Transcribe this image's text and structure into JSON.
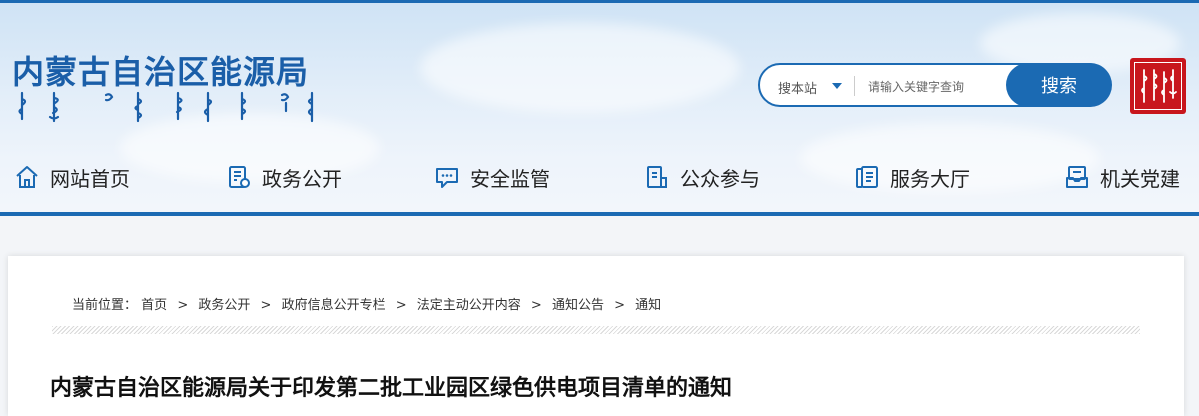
{
  "header": {
    "site_title": "内蒙古自治区能源局",
    "search": {
      "scope_label": "搜本站",
      "placeholder": "请输入关键字查询",
      "button_label": "搜索"
    }
  },
  "nav": {
    "items": [
      {
        "label": "网站首页",
        "icon": "home-icon"
      },
      {
        "label": "政务公开",
        "icon": "document-settings-icon"
      },
      {
        "label": "安全监管",
        "icon": "chat-bubble-icon"
      },
      {
        "label": "公众参与",
        "icon": "clipboard-icon"
      },
      {
        "label": "服务大厅",
        "icon": "list-document-icon"
      },
      {
        "label": "机关党建",
        "icon": "inbox-icon"
      }
    ]
  },
  "breadcrumb": {
    "prefix": "当前位置：",
    "items": [
      "首页",
      "政务公开",
      "政府信息公开专栏",
      "法定主动公开内容",
      "通知公告",
      "通知"
    ],
    "separator": ">"
  },
  "article": {
    "title": "内蒙古自治区能源局关于印发第二批工业园区绿色供电项目清单的通知"
  },
  "colors": {
    "brand_blue": "#1b6ab3",
    "title_blue": "#1a5ea8",
    "seal_red": "#c8161d"
  }
}
